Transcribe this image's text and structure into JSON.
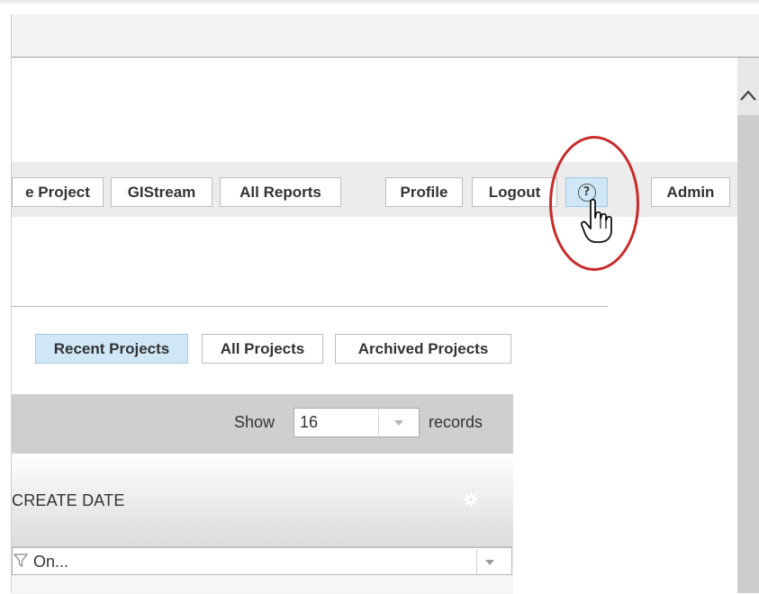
{
  "nav": {
    "buttons": {
      "create_project": "e Project",
      "gistream": "GIStream",
      "all_reports": "All Reports",
      "profile": "Profile",
      "logout": "Logout",
      "admin": "Admin"
    },
    "help_glyph": "?",
    "help_icon": "question-circle-icon",
    "highlight_color": "#c92a2a"
  },
  "project_tabs": {
    "recent": "Recent Projects",
    "all": "All Projects",
    "archived": "Archived Projects",
    "active_color": "#cfe7f7"
  },
  "grid": {
    "show_label": "Show",
    "records_value": "16",
    "records_label": "records",
    "column_header": "CREATE DATE",
    "filter_value": "On..."
  },
  "icons": {
    "gear": "gear-icon",
    "filter": "filter-icon",
    "dropdown": "chevron-down-icon",
    "scroll_up": "chevron-up-icon",
    "cursor": "hand-pointer-icon"
  }
}
